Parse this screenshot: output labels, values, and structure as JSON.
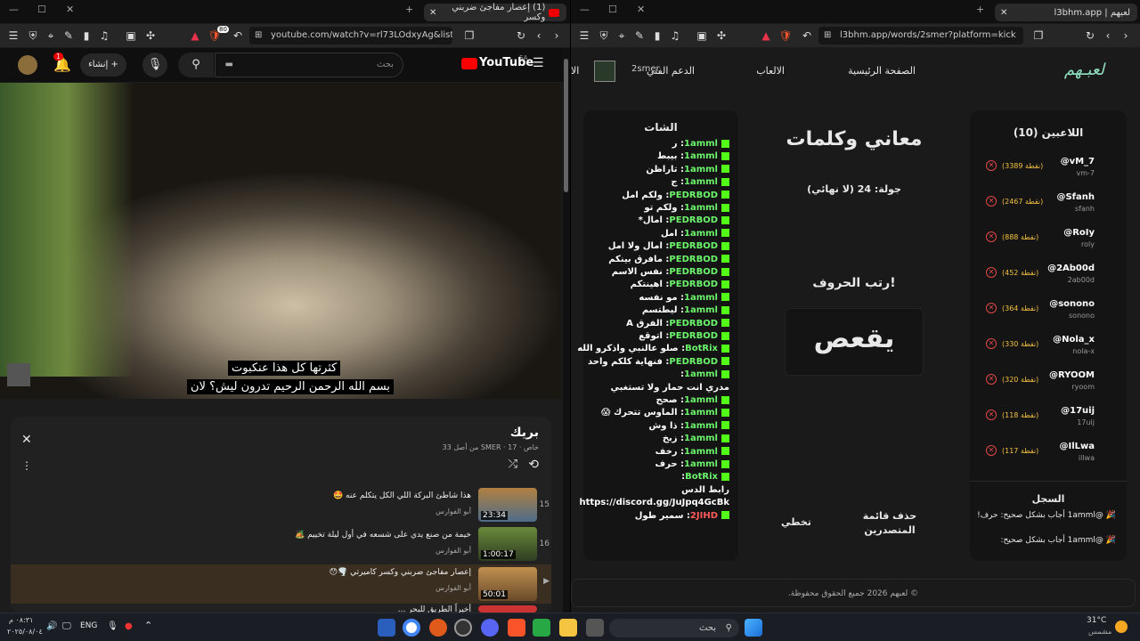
{
  "left_browser": {
    "tab_title": "(1) إعصار مفاجئ ضربني وكسر",
    "url": "youtube.com/watch?v=rl73LOdxyAg&list=...",
    "shield_count": "80",
    "youtube": {
      "logo": "YouTube",
      "region": "SA",
      "search_placeholder": "بحث",
      "create_label": "إنشاء",
      "notif_count": "1"
    },
    "subtitles": [
      "كثرتها كل هذا عنكبوت",
      "بسم الله الرحمن الرحيم تدرون ليش؟ لان"
    ],
    "playlist": {
      "title": "بريك",
      "meta": "خاص · SMER · 17 من أصل 33",
      "items": [
        {
          "num": "15",
          "title": "هذا شاطئ البركة اللي الكل يتكلم عنه 🤩",
          "channel": "أبو الفوارس",
          "duration": "23:34"
        },
        {
          "num": "16",
          "title": "خيمة من صنع يدي على شسعه في أول ليلة تخييم 🏕️",
          "channel": "أبو الفوارس",
          "duration": "1:00:17"
        },
        {
          "num": "▶",
          "title": "إعصار مفاجئ ضربني وكسر كاميرتي 🌪️😯",
          "channel": "أبو الفوارس",
          "duration": "50:01"
        },
        {
          "num": "",
          "title": "أخيراً الطريق للبحر ...",
          "channel": "",
          "duration": ""
        }
      ]
    }
  },
  "right_browser": {
    "tab_title": "لعبهم | l3bhm.app",
    "url": "l3bhm.app/words/2smer?platform=kick",
    "nav": {
      "logo": "لعبـهم",
      "home": "الصفحة الرئيسية",
      "games": "الالعاب",
      "support": "الدعم الفني",
      "user": "2smer",
      "cut": "الا"
    },
    "players_title": "اللاعبين (10)",
    "players": [
      {
        "name": "@vM_7",
        "sub": "vm-7",
        "points": "(3389 نقطة)"
      },
      {
        "name": "@Sfanh",
        "sub": "sfanh",
        "points": "(2467 نقطة)"
      },
      {
        "name": "@RoIy",
        "sub": "roly",
        "points": "(888 نقطة)"
      },
      {
        "name": "@2Ab00d",
        "sub": "2ab00d",
        "points": "(452 نقطة)"
      },
      {
        "name": "@sonono",
        "sub": "sonono",
        "points": "(364 نقطة)"
      },
      {
        "name": "@Nola_x",
        "sub": "nola-x",
        "points": "(330 نقطة)"
      },
      {
        "name": "@RYOOM",
        "sub": "ryoom",
        "points": "(320 نقطة)"
      },
      {
        "name": "@17uij",
        "sub": "17uij",
        "points": "(118 نقطة)"
      },
      {
        "name": "@IlLwa",
        "sub": "illwa",
        "points": "(117 نقطة)"
      }
    ],
    "log_title": "السجل",
    "log": [
      "🎉 @1amml أجاب بشكل صحيح: حرف!",
      "🎉 @1amml أجاب بشكل صحيح:"
    ],
    "game_title": "معاني وكلمات",
    "round": "جولة: 24 (لا نهائي)",
    "prompt": "رتب الحروف!",
    "letters": "يقعص",
    "clear_board": "حذف قائمة المتصدرين",
    "skip": "تخطي",
    "chat_title": "الشات",
    "chat": [
      {
        "u": "1amml",
        "m": "ر"
      },
      {
        "u": "1amml",
        "m": "بيبط"
      },
      {
        "u": "1amml",
        "m": "تاراظن"
      },
      {
        "u": "1amml",
        "m": "ج"
      },
      {
        "u": "PEDRBOD",
        "m": "ولكم امل"
      },
      {
        "u": "1amml",
        "m": "ولكم تو"
      },
      {
        "u": "PEDRBOD",
        "m": "امال*"
      },
      {
        "u": "1amml",
        "m": "امل"
      },
      {
        "u": "PEDRBOD",
        "m": "امال ولا امل"
      },
      {
        "u": "PEDRBOD",
        "m": "مافرق بينكم"
      },
      {
        "u": "PEDRBOD",
        "m": "نفس الاسم"
      },
      {
        "u": "PEDRBOD",
        "m": "اهينتكم"
      },
      {
        "u": "1amml",
        "m": "مو نفسه"
      },
      {
        "u": "1amml",
        "m": "ليطتسم"
      },
      {
        "u": "PEDRBOD",
        "m": "الفرق A"
      },
      {
        "u": "PEDRBOD",
        "m": "اتوقع"
      },
      {
        "u": "BotRix",
        "m": "صلو عالنبي واذكرو الله"
      },
      {
        "u": "PEDRBOD",
        "m": "فنهاية كلكم واحد"
      },
      {
        "u": "1amml",
        "m": ""
      },
      {
        "u": "",
        "m": "مدري انت حمار ولا تستغبي"
      },
      {
        "u": "1amml",
        "m": "صحح"
      },
      {
        "u": "1amml",
        "m": "الماوس تتحرك 😱"
      },
      {
        "u": "1amml",
        "m": "ذا وش"
      },
      {
        "u": "1amml",
        "m": "زبخ"
      },
      {
        "u": "1amml",
        "m": "رخف"
      },
      {
        "u": "1amml",
        "m": "حرف"
      },
      {
        "u": "BotRix",
        "m": ""
      },
      {
        "u": "",
        "m": "رابط الدس"
      },
      {
        "u": "",
        "m": "https://discord.gg/JuJpq4GcBk"
      },
      {
        "u": "2JIHD",
        "m": "سمير طول"
      }
    ],
    "footer": "© لعبهم 2026 جميع الحقوق محفوظة."
  },
  "taskbar": {
    "time": "٠٨:٣١ م",
    "date": "٢٠٢٥/٠٨/٠٤",
    "lang": "ENG",
    "search": "بحث",
    "temp": "31°C",
    "weather": "مشمس"
  }
}
